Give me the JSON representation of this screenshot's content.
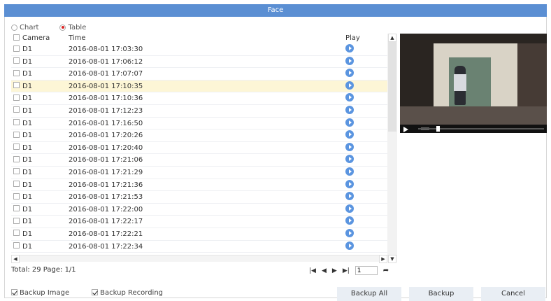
{
  "window": {
    "title": "Face"
  },
  "view_mode": {
    "options": [
      {
        "label": "Chart",
        "selected": false
      },
      {
        "label": "Table",
        "selected": true
      }
    ]
  },
  "table": {
    "headers": {
      "camera": "Camera",
      "time": "Time",
      "play": "Play"
    },
    "rows": [
      {
        "camera": "D1",
        "time": "2016-08-01 17:03:30"
      },
      {
        "camera": "D1",
        "time": "2016-08-01 17:06:12"
      },
      {
        "camera": "D1",
        "time": "2016-08-01 17:07:07"
      },
      {
        "camera": "D1",
        "time": "2016-08-01 17:10:35",
        "selected": true
      },
      {
        "camera": "D1",
        "time": "2016-08-01 17:10:36"
      },
      {
        "camera": "D1",
        "time": "2016-08-01 17:12:23"
      },
      {
        "camera": "D1",
        "time": "2016-08-01 17:16:50"
      },
      {
        "camera": "D1",
        "time": "2016-08-01 17:20:26"
      },
      {
        "camera": "D1",
        "time": "2016-08-01 17:20:40"
      },
      {
        "camera": "D1",
        "time": "2016-08-01 17:21:06"
      },
      {
        "camera": "D1",
        "time": "2016-08-01 17:21:29"
      },
      {
        "camera": "D1",
        "time": "2016-08-01 17:21:36"
      },
      {
        "camera": "D1",
        "time": "2016-08-01 17:21:53"
      },
      {
        "camera": "D1",
        "time": "2016-08-01 17:22:00"
      },
      {
        "camera": "D1",
        "time": "2016-08-01 17:22:17"
      },
      {
        "camera": "D1",
        "time": "2016-08-01 17:22:21"
      },
      {
        "camera": "D1",
        "time": "2016-08-01 17:22:34"
      }
    ]
  },
  "pagination": {
    "total_label": "Total: 29  Page: 1/1",
    "page_input": "1",
    "icons": [
      "first-page-icon",
      "prev-page-icon",
      "next-page-icon",
      "last-page-icon",
      "go-icon"
    ]
  },
  "footer": {
    "backup_image_label": "Backup Image",
    "backup_recording_label": "Backup Recording",
    "backup_all_label": "Backup All",
    "backup_label": "Backup",
    "cancel_label": "Cancel"
  },
  "colors": {
    "title_bar": "#5b8fd3",
    "selected_row": "#fdf6d6",
    "play_icon": "#5b95e0",
    "button": "#e9eef4"
  }
}
